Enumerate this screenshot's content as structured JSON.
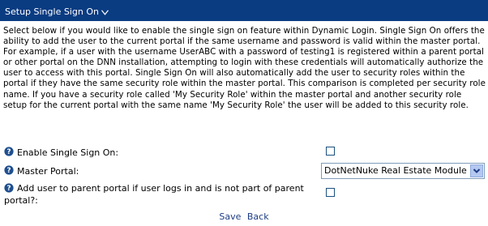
{
  "header": {
    "title": "Setup Single Sign On",
    "toggle_icon": "chevron-down-icon",
    "background": "#0a3c82"
  },
  "description": "Select below if you would like to enable the single sign on feature within Dynamic Login. Single Sign On offers the ability to add the user to the current portal if the same username and password is valid within the master portal. For example, if a user with the username UserABC with a password of testing1 is registered within a parent portal or other portal on the DNN installation, attempting to login with these credentials will automatically authorize the user to access with this portal. Single Sign On will also automatically add the user to security roles within the portal if they have the same security role within the master portal. This comparison is completed per security role name. If you have a security role called 'My Security Role' within the master portal and another security role setup for the current portal with the same name 'My Security Role' the user will be added to this security role.",
  "fields": {
    "enable_sso": {
      "label": "Enable Single Sign On:",
      "checked": false
    },
    "master_portal": {
      "label": "Master Portal:",
      "value": "DotNetNuke Real Estate Module"
    },
    "add_user": {
      "label_line1": "Add user to parent portal if user logs in and is not part of parent",
      "label_line2": "portal?:",
      "checked": false
    }
  },
  "actions": {
    "save": "Save",
    "back": "Back"
  },
  "icons": {
    "help": "help-icon"
  }
}
